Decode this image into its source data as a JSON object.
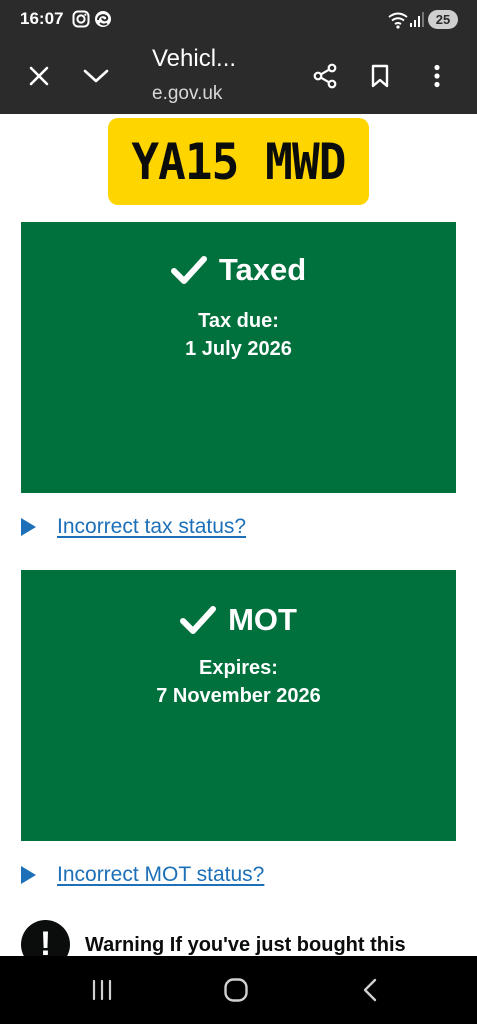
{
  "status_bar": {
    "time": "16:07",
    "icons": [
      "instagram-icon",
      "edge-browser-icon",
      "wifi-icon",
      "signal-icon"
    ],
    "battery": "25"
  },
  "toolbar": {
    "title": "Vehicl...",
    "url": "e.gov.uk",
    "icons": [
      "close-icon",
      "chevron-down-icon",
      "share-icon",
      "bookmark-icon",
      "more-vert-icon"
    ]
  },
  "vehicle": {
    "registration": "YA15 MWD"
  },
  "tax": {
    "status": "Taxed",
    "due_label": "Tax due:",
    "due_date": "1 July 2026",
    "details_summary": "Incorrect tax status?"
  },
  "mot": {
    "status": "MOT",
    "expires_label": "Expires:",
    "expires_date": "7 November 2026",
    "details_summary": "Incorrect MOT status?"
  },
  "warning": {
    "icon_text": "!",
    "text": "Warning If you've just bought this"
  },
  "nav_bar": {
    "icons": [
      "recent-apps-icon",
      "home-icon",
      "back-icon"
    ]
  },
  "colors": {
    "status_green": "#00703c",
    "plate_yellow": "#ffd500",
    "link_blue": "#1d70b8",
    "toolbar_dark": "#2b2b2b"
  }
}
